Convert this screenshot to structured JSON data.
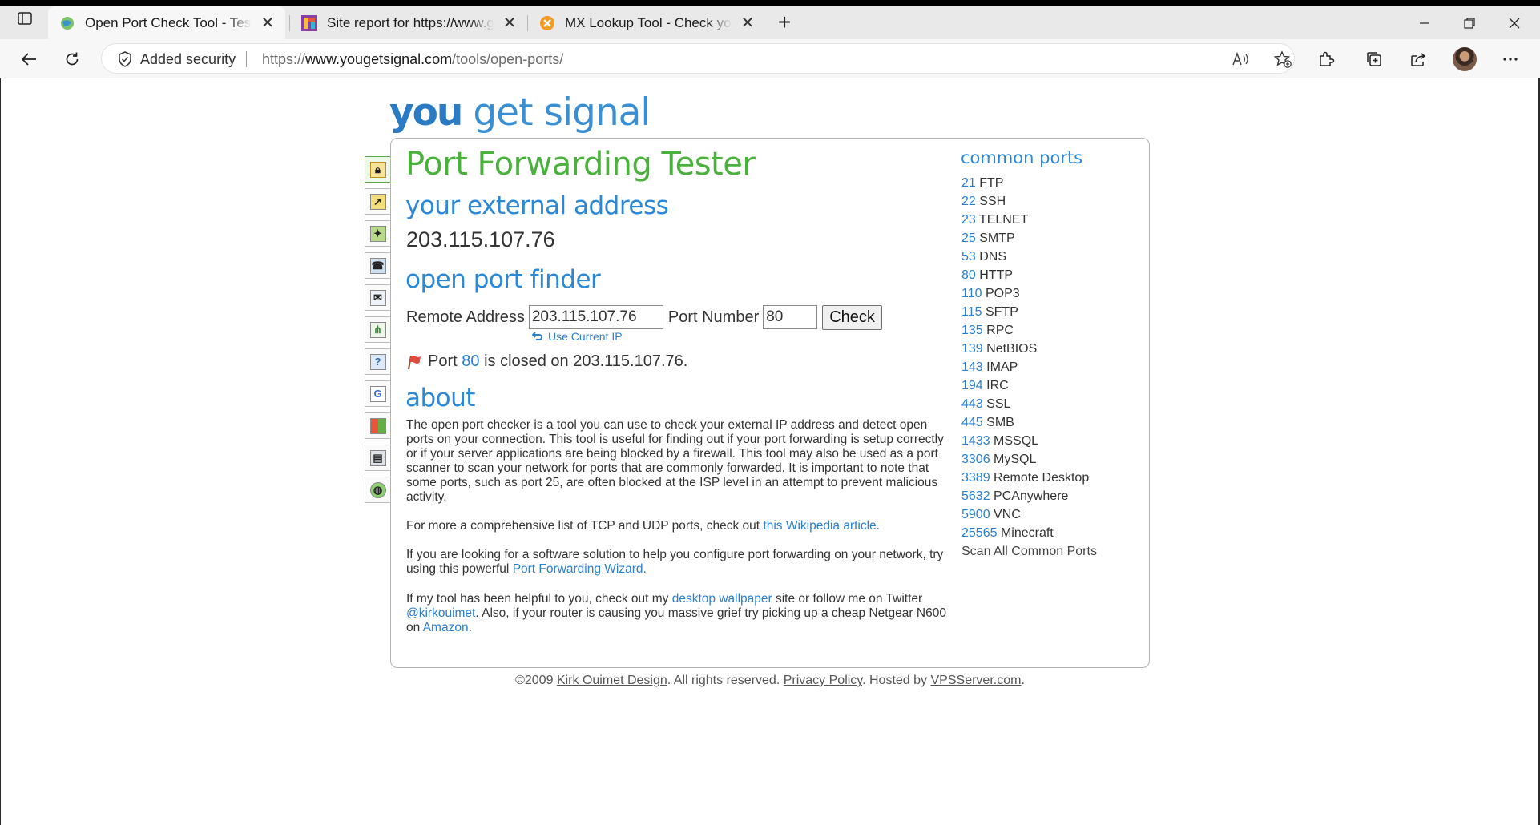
{
  "browser": {
    "tabs": [
      {
        "title": "Open Port Check Tool - Test Port Forwarding",
        "favicon": "globe-icon",
        "active": true
      },
      {
        "title": "Site report for https://www.google.com",
        "favicon": "netcraft-icon",
        "active": false
      },
      {
        "title": "MX Lookup Tool - Check your DNS MX Records",
        "favicon": "mxtoolbox-icon",
        "active": false
      }
    ],
    "security_label": "Added security",
    "url_prefix": "https://",
    "url_host": "www.yougetsignal.com",
    "url_path": "/tools/open-ports/"
  },
  "logo": {
    "you": "you",
    "rest": "get signal"
  },
  "sidebar_icons": [
    "lock-icon",
    "chart-icon",
    "map-icon",
    "phone-icon",
    "mail-icon",
    "network-icon",
    "help-icon",
    "google-icon",
    "windows-icon",
    "server-icon",
    "globe-icon"
  ],
  "main": {
    "title": "Port Forwarding Tester",
    "external_heading": "your external address",
    "external_ip": "203.115.107.76",
    "finder_heading": "open port finder",
    "remote_label": "Remote Address",
    "remote_value": "203.115.107.76",
    "port_label": "Port Number",
    "port_value": "80",
    "check_label": "Check",
    "use_current": "Use Current IP",
    "result": {
      "prefix": "Port",
      "port": "80",
      "suffix": "is closed on 203.115.107.76."
    },
    "about_heading": "about",
    "about_p1": "The open port checker is a tool you can use to check your external IP address and detect open ports on your connection. This tool is useful for finding out if your port forwarding is setup correctly or if your server applications are being blocked by a firewall. This tool may also be used as a port scanner to scan your network for ports that are commonly forwarded. It is important to note that some ports, such as port 25, are often blocked at the ISP level in an attempt to prevent malicious activity.",
    "about_p2_text": "For more a comprehensive list of TCP and UDP ports, check out",
    "about_p2_link": "this Wikipedia article.",
    "about_p3_text": "If you are looking for a software solution to help you configure port forwarding on your network, try using this powerful",
    "about_p3_link": "Port Forwarding Wizard.",
    "about_p4_a": "If my tool has been helpful to you, check out my",
    "about_p4_link1": "desktop wallpaper",
    "about_p4_b": "site or follow me on Twitter",
    "about_p4_link2": "@kirkouimet",
    "about_p4_c": ". Also, if your router is causing you massive grief try picking up a cheap Netgear N600 on",
    "about_p4_link3": "Amazon",
    "about_p4_d": "."
  },
  "common_ports": {
    "title": "common ports",
    "items": [
      {
        "port": "21",
        "name": "FTP"
      },
      {
        "port": "22",
        "name": "SSH"
      },
      {
        "port": "23",
        "name": "TELNET"
      },
      {
        "port": "25",
        "name": "SMTP"
      },
      {
        "port": "53",
        "name": "DNS"
      },
      {
        "port": "80",
        "name": "HTTP"
      },
      {
        "port": "110",
        "name": "POP3"
      },
      {
        "port": "115",
        "name": "SFTP"
      },
      {
        "port": "135",
        "name": "RPC"
      },
      {
        "port": "139",
        "name": "NetBIOS"
      },
      {
        "port": "143",
        "name": "IMAP"
      },
      {
        "port": "194",
        "name": "IRC"
      },
      {
        "port": "443",
        "name": "SSL"
      },
      {
        "port": "445",
        "name": "SMB"
      },
      {
        "port": "1433",
        "name": "MSSQL"
      },
      {
        "port": "3306",
        "name": "MySQL"
      },
      {
        "port": "3389",
        "name": "Remote Desktop"
      },
      {
        "port": "5632",
        "name": "PCAnywhere"
      },
      {
        "port": "5900",
        "name": "VNC"
      },
      {
        "port": "25565",
        "name": "Minecraft"
      }
    ],
    "scan_all": "Scan All Common Ports"
  },
  "footer": {
    "copy": "©2009",
    "author": "Kirk Ouimet Design",
    "rights": ". All rights reserved.",
    "privacy": "Privacy Policy",
    "hosted": ". Hosted by",
    "host": "VPSServer.com",
    "end": "."
  }
}
